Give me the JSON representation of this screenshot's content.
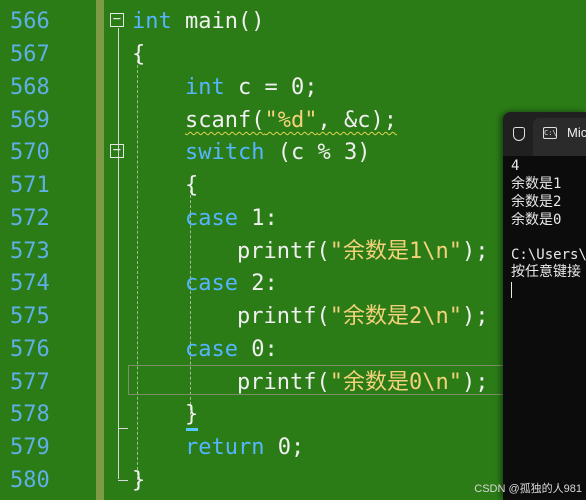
{
  "editor": {
    "line_numbers": [
      "566",
      "567",
      "568",
      "569",
      "570",
      "571",
      "572",
      "573",
      "574",
      "575",
      "576",
      "577",
      "578",
      "579",
      "580"
    ],
    "code": {
      "l566_kw": "int",
      "l566_rest": " main()",
      "l567": "{",
      "l568_kw": "int",
      "l568_rest": " c = 0;",
      "l569_fn": "scanf(",
      "l569_str": "\"%d\"",
      "l569_rest": ", &c);",
      "l570_kw": "switch",
      "l570_rest": " (c % 3)",
      "l571": "{",
      "l572_kw": "case",
      "l572_rest": " 1:",
      "l573_fn": "printf(",
      "l573_str": "\"余数是1\\n\"",
      "l573_rest": ");",
      "l574_kw": "case",
      "l574_rest": " 2:",
      "l575_fn": "printf(",
      "l575_str": "\"余数是2\\n\"",
      "l575_rest": ");",
      "l576_kw": "case",
      "l576_rest": " 0:",
      "l577_fn": "printf(",
      "l577_str": "\"余数是0\\n\"",
      "l577_rest": ");",
      "l578": "}",
      "l579_kw": "return",
      "l579_rest": " 0;",
      "l580": "}"
    },
    "fold_symbol": "−",
    "colors": {
      "background": "#2b7b17",
      "keyword": "#55b5ff",
      "line_number": "#5fb0e6",
      "string": "#f3d27a"
    }
  },
  "terminal": {
    "tab_title": "Mic",
    "tab_icon": "C:\\",
    "output": [
      "4",
      "余数是1",
      "余数是2",
      "余数是0",
      "",
      "C:\\Users\\",
      "按任意键接"
    ]
  },
  "watermark": "CSDN @孤独的人981"
}
